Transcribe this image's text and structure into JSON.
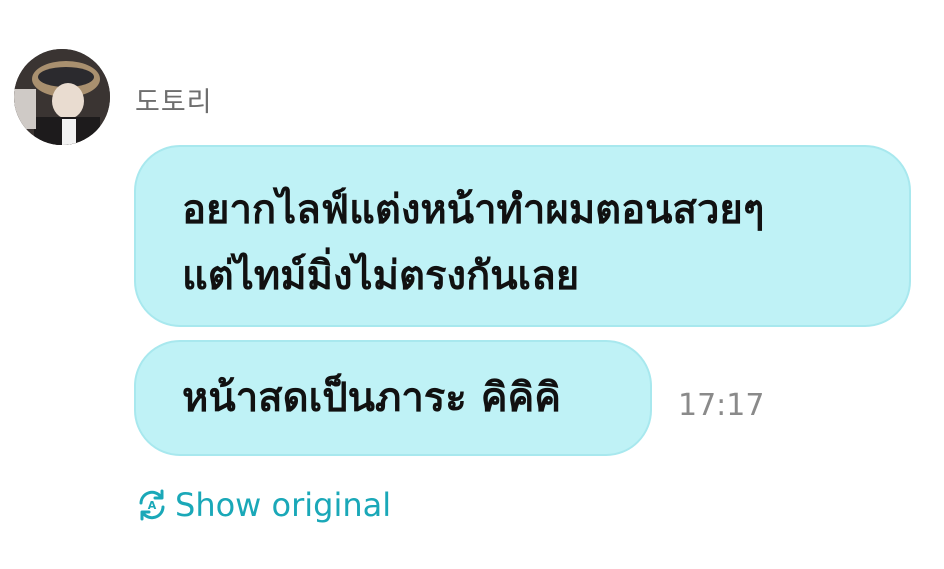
{
  "sender": {
    "name": "도토리",
    "avatar_icon": "profile-photo-icon"
  },
  "messages": [
    {
      "lines": [
        "อยากไลฟ์แต่งหน้าทำผมตอนสวยๆ",
        "แต่ไทม์มิ่งไม่ตรงกันเลย"
      ]
    },
    {
      "text": "หน้าสดเป็นภาระ คิคิคิ",
      "time": "17:17"
    }
  ],
  "translation": {
    "label": "Show original",
    "icon": "translate-refresh-icon"
  },
  "colors": {
    "bubble": "#bff2f6",
    "accent": "#1aa8b8"
  }
}
